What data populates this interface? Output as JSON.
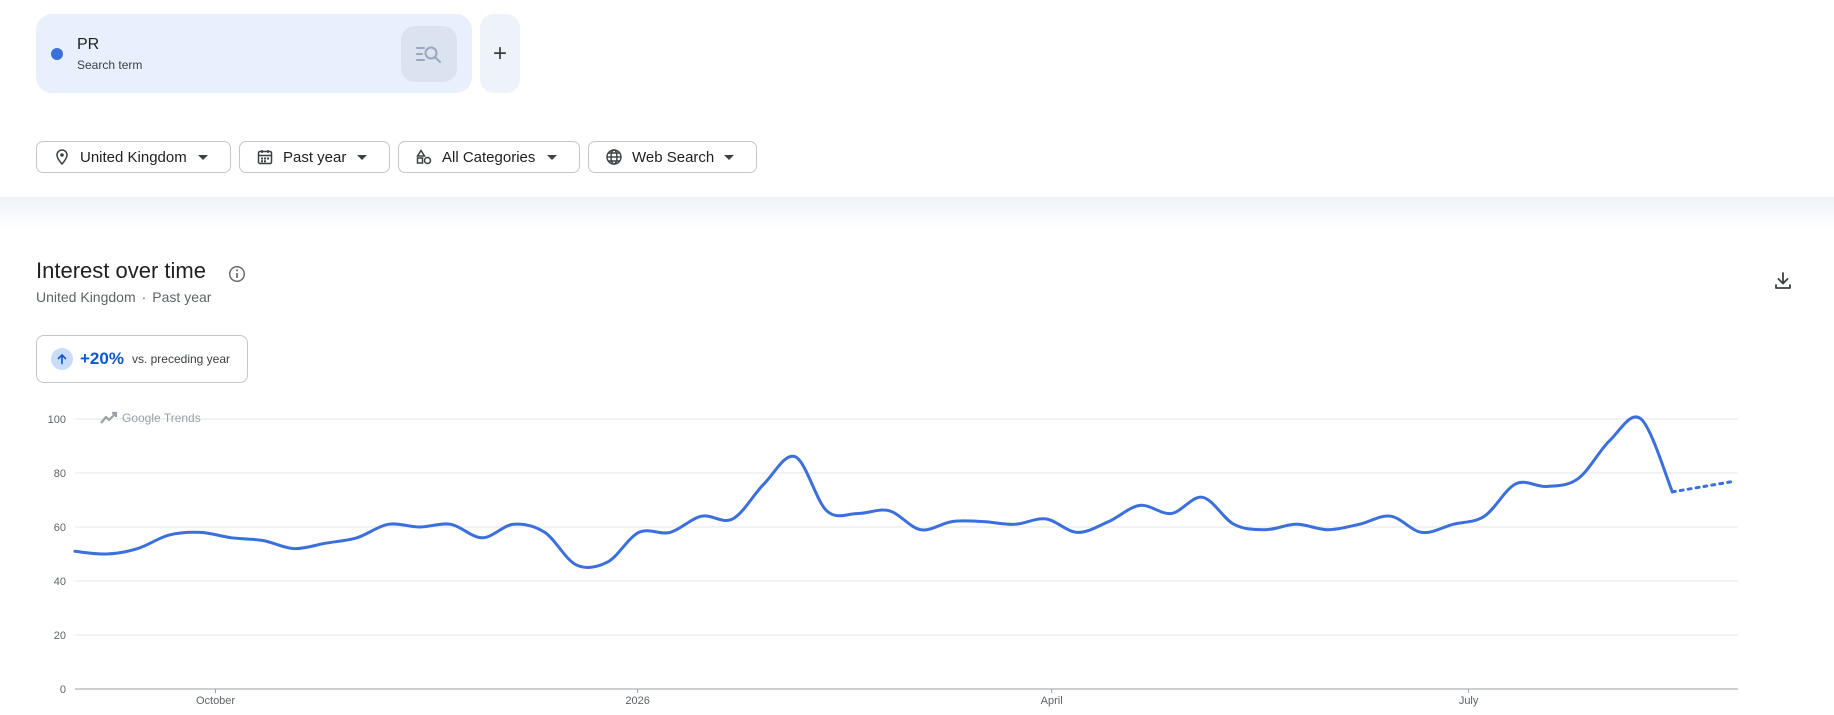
{
  "search": {
    "term": "PR",
    "term_subtitle": "Search term",
    "term_color": "#3b6fdc",
    "search_icon": "search-list-icon",
    "add_label": "+"
  },
  "filters": [
    {
      "label": "United Kingdom",
      "icon": "location-pin-icon"
    },
    {
      "label": "Past year",
      "icon": "calendar-icon"
    },
    {
      "label": "All Categories",
      "icon": "categories-icon"
    },
    {
      "label": "Web Search",
      "icon": "globe-icon"
    }
  ],
  "section": {
    "title": "Interest over time",
    "subtitle_location": "United Kingdom",
    "subtitle_separator": "·",
    "subtitle_period": "Past year"
  },
  "stat": {
    "value": "+20%",
    "label": "vs. preceding year"
  },
  "watermark": "Google Trends",
  "chart_data": {
    "type": "line",
    "y_ticks": [
      "100",
      "80",
      "60",
      "40",
      "20",
      "0"
    ],
    "ylim": [
      0,
      100
    ],
    "x_ticks": [
      "October",
      "2026",
      "April",
      "July"
    ],
    "grid": true,
    "line_color": "#3b6fdc",
    "series": [
      {
        "values": [
          51,
          50,
          52,
          57,
          58,
          56,
          55,
          52,
          54,
          56,
          61,
          60,
          61,
          56,
          61,
          58,
          46,
          47,
          58,
          58,
          64,
          63,
          76,
          86,
          66,
          65,
          66,
          59,
          62,
          62,
          61,
          63,
          58,
          62,
          68,
          65,
          71,
          61,
          59,
          61,
          59,
          61,
          64,
          58,
          61,
          64,
          76,
          75,
          78,
          92,
          100,
          73
        ],
        "partial": [
          73,
          75,
          77
        ]
      }
    ]
  }
}
